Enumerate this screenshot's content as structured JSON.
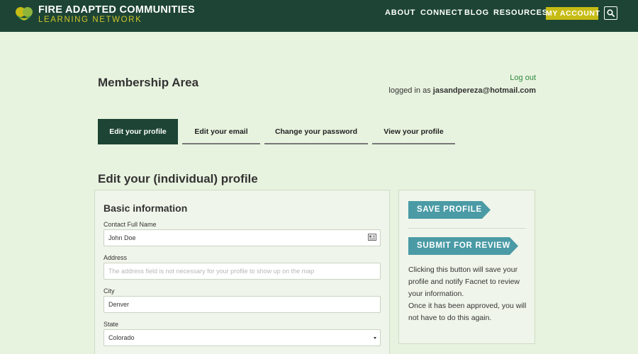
{
  "header": {
    "brand_line1": "FIRE ADAPTED COMMUNITIES",
    "brand_line2": "LEARNING NETWORK",
    "logo_icon": "facnet-logo-icon",
    "nav": {
      "about": "ABOUT",
      "connect": "CONNECT",
      "blog": "BLOG",
      "resources": "RESOURCES"
    },
    "my_account": "MY ACCOUNT",
    "search_icon": "search-icon"
  },
  "membership": {
    "title": "Membership Area",
    "logout": "Log out",
    "logged_in_prefix": "logged in as",
    "user_email": "jasandpereza@hotmail.com"
  },
  "tabs": [
    {
      "label": "Edit your profile",
      "active": true
    },
    {
      "label": "Edit your email",
      "active": false
    },
    {
      "label": "Change your password",
      "active": false
    },
    {
      "label": "View your profile",
      "active": false
    }
  ],
  "form": {
    "section_title": "Edit your (individual) profile",
    "panel_title": "Basic information",
    "fields": {
      "name": {
        "label": "Contact Full Name",
        "value": "John Doe",
        "icon": "contact-card-icon"
      },
      "address": {
        "label": "Address",
        "value": "",
        "placeholder": "The address field is not necessary for your profile to show up on the map"
      },
      "city": {
        "label": "City",
        "value": "Denver"
      },
      "state": {
        "label": "State",
        "value": "Colorado"
      }
    }
  },
  "sidebar": {
    "save_label": "SAVE PROFILE",
    "submit_label": "SUBMIT FOR REVIEW",
    "note_line1": "Clicking this button will save your profile and notify Facnet to review your information.",
    "note_line2": "Once it has been approved, you will not have to do this again."
  },
  "colors": {
    "header_bg": "#1d4435",
    "accent_yellow": "#c7bc15",
    "button_teal": "#4a9ba5",
    "page_bg": "#e8f3df",
    "link_green": "#2e8a3e"
  }
}
